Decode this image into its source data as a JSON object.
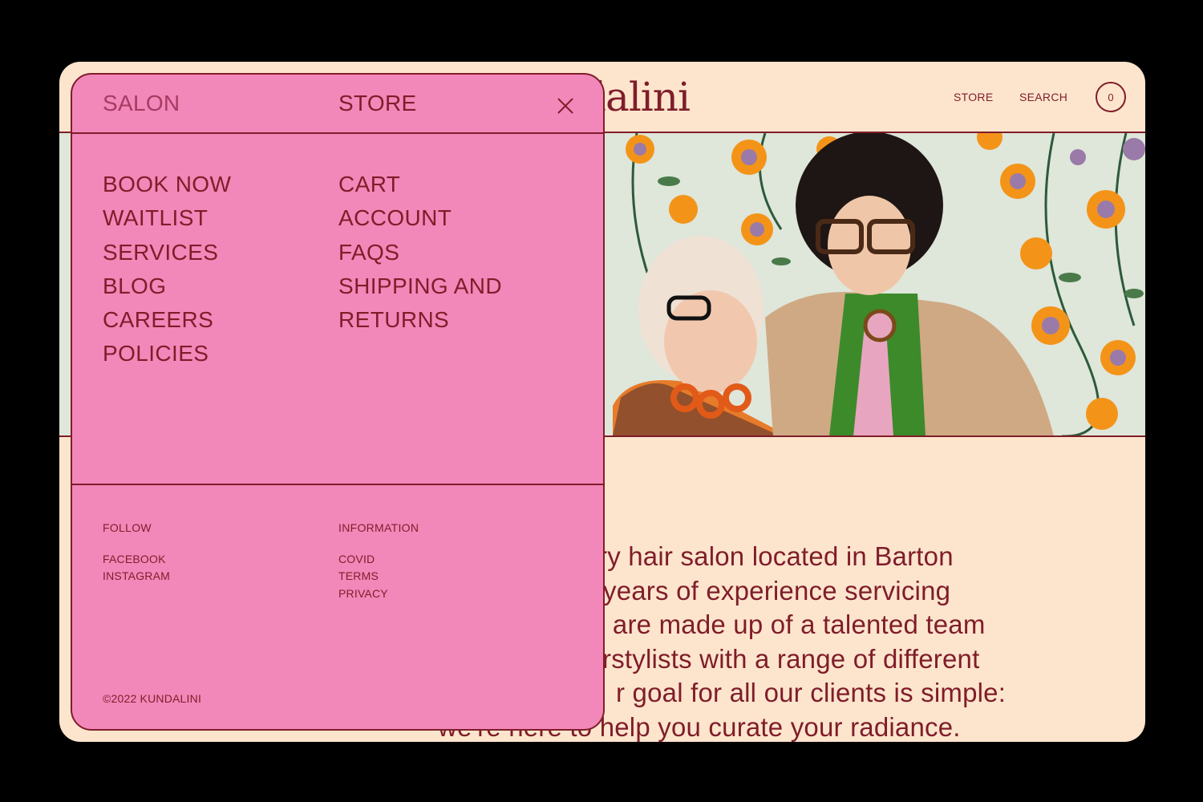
{
  "header": {
    "logo_text": "dalini",
    "nav": [
      "STORE",
      "SEARCH"
    ],
    "cart_count": "0"
  },
  "intro_lines": [
    "ry hair salon located in Barton",
    "years of experience servicing",
    "e are made up of a talented team",
    "rstylists with a range of different",
    "r goal for all our clients is simple:",
    "we're here to help you curate your radiance."
  ],
  "menu": {
    "tabs": {
      "salon": "SALON",
      "store": "STORE"
    },
    "salon_links": [
      "BOOK NOW",
      "WAITLIST",
      "SERVICES",
      "BLOG",
      "CAREERS",
      "POLICIES"
    ],
    "store_links": [
      "CART",
      "ACCOUNT",
      "FAQS",
      "SHIPPING AND",
      "RETURNS"
    ],
    "follow": {
      "heading": "FOLLOW",
      "links": [
        "FACEBOOK",
        "INSTAGRAM"
      ]
    },
    "information": {
      "heading": "INFORMATION",
      "links": [
        "COVID",
        "TERMS",
        "PRIVACY"
      ]
    },
    "copyright": "©2022 KUNDALINI"
  },
  "colors": {
    "page_bg": "#000000",
    "cream": "#fde5cd",
    "menu_pink": "#f287b9",
    "burgundy": "#7f1d2a"
  },
  "icons": {
    "close": "close-icon"
  }
}
